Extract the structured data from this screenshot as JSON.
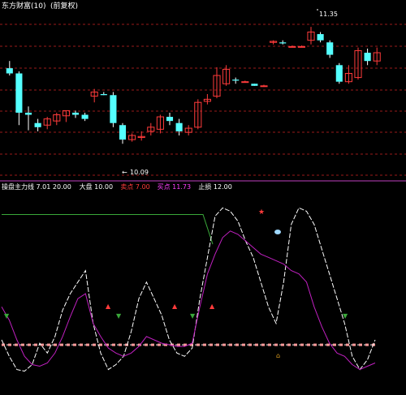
{
  "price_panel": {
    "header_label": "东方财富(10)",
    "header_sub": "(前复权)",
    "high_label": "11.35",
    "low_label": "10.09"
  },
  "indicator_panel": {
    "header_items": [
      {
        "text": "操盘主力线 7.01 20.00",
        "color": "#ffffff"
      },
      {
        "text": "大盘 10.00",
        "color": "#ffffff"
      },
      {
        "text": "卖点 7.00",
        "color": "#ff3b3b"
      },
      {
        "text": "买点 11.73",
        "color": "#ff40ff"
      },
      {
        "text": "止损 12.00",
        "color": "#ffffff"
      }
    ]
  },
  "colors": {
    "up": "#ff3b3b",
    "down": "#54ffff",
    "wick": "#ffffff",
    "grid": "#9a1a1a",
    "ma_white": "#ffffff",
    "ma_magenta": "#c020c0",
    "level_green": "#3aa83a",
    "band": "#ff9a9a"
  },
  "chart_data": [
    {
      "type": "candlestick",
      "title": "",
      "ylim": [
        9.9,
        11.5
      ],
      "candles": [
        {
          "o": 10.95,
          "h": 11.02,
          "l": 10.88,
          "c": 10.9
        },
        {
          "o": 10.9,
          "h": 10.92,
          "l": 10.4,
          "c": 10.52
        },
        {
          "o": 10.52,
          "h": 10.58,
          "l": 10.35,
          "c": 10.5
        },
        {
          "o": 10.42,
          "h": 10.46,
          "l": 10.34,
          "c": 10.38
        },
        {
          "o": 10.4,
          "h": 10.48,
          "l": 10.36,
          "c": 10.46
        },
        {
          "o": 10.44,
          "h": 10.52,
          "l": 10.4,
          "c": 10.5
        },
        {
          "o": 10.49,
          "h": 10.54,
          "l": 10.43,
          "c": 10.54
        },
        {
          "o": 10.52,
          "h": 10.54,
          "l": 10.47,
          "c": 10.5
        },
        {
          "o": 10.5,
          "h": 10.52,
          "l": 10.44,
          "c": 10.46
        },
        {
          "o": 10.68,
          "h": 10.75,
          "l": 10.62,
          "c": 10.72
        },
        {
          "o": 10.7,
          "h": 10.72,
          "l": 10.69,
          "c": 10.69
        },
        {
          "o": 10.69,
          "h": 10.72,
          "l": 10.38,
          "c": 10.42
        },
        {
          "o": 10.4,
          "h": 10.42,
          "l": 10.22,
          "c": 10.26
        },
        {
          "o": 10.26,
          "h": 10.32,
          "l": 10.24,
          "c": 10.3
        },
        {
          "o": 10.28,
          "h": 10.34,
          "l": 10.25,
          "c": 10.29
        },
        {
          "o": 10.34,
          "h": 10.42,
          "l": 10.3,
          "c": 10.38
        },
        {
          "o": 10.36,
          "h": 10.5,
          "l": 10.32,
          "c": 10.48
        },
        {
          "o": 10.48,
          "h": 10.52,
          "l": 10.4,
          "c": 10.44
        },
        {
          "o": 10.42,
          "h": 10.46,
          "l": 10.3,
          "c": 10.34
        },
        {
          "o": 10.33,
          "h": 10.4,
          "l": 10.3,
          "c": 10.37
        },
        {
          "o": 10.38,
          "h": 10.65,
          "l": 10.36,
          "c": 10.62
        },
        {
          "o": 10.63,
          "h": 10.7,
          "l": 10.6,
          "c": 10.65
        },
        {
          "o": 10.68,
          "h": 10.96,
          "l": 10.66,
          "c": 10.88
        },
        {
          "o": 10.8,
          "h": 10.98,
          "l": 10.78,
          "c": 10.94
        },
        {
          "o": 10.84,
          "h": 10.86,
          "l": 10.8,
          "c": 10.83
        },
        {
          "o": 10.82,
          "h": 10.83,
          "l": 10.82,
          "c": 10.82
        },
        {
          "o": 10.8,
          "h": 10.8,
          "l": 10.78,
          "c": 10.78
        },
        {
          "o": 10.78,
          "h": 10.79,
          "l": 10.77,
          "c": 10.78
        },
        {
          "o": 11.2,
          "h": 11.22,
          "l": 11.18,
          "c": 11.21
        },
        {
          "o": 11.2,
          "h": 11.22,
          "l": 11.18,
          "c": 11.19
        },
        {
          "o": 11.16,
          "h": 11.17,
          "l": 11.15,
          "c": 11.16
        },
        {
          "o": 11.16,
          "h": 11.17,
          "l": 11.15,
          "c": 11.16
        },
        {
          "o": 11.22,
          "h": 11.35,
          "l": 11.18,
          "c": 11.3
        },
        {
          "o": 11.28,
          "h": 11.3,
          "l": 11.2,
          "c": 11.22
        },
        {
          "o": 11.2,
          "h": 11.22,
          "l": 11.05,
          "c": 11.08
        },
        {
          "o": 10.98,
          "h": 11.0,
          "l": 10.8,
          "c": 10.82
        },
        {
          "o": 10.82,
          "h": 10.98,
          "l": 10.8,
          "c": 10.9
        },
        {
          "o": 10.86,
          "h": 11.15,
          "l": 10.84,
          "c": 11.12
        },
        {
          "o": 11.1,
          "h": 11.14,
          "l": 10.98,
          "c": 11.02
        },
        {
          "o": 11.02,
          "h": 11.15,
          "l": 10.98,
          "c": 11.1
        }
      ]
    },
    {
      "type": "line",
      "title": "",
      "ylim": [
        -10,
        110
      ],
      "reference_levels": [
        {
          "name": "upper",
          "value": 96
        },
        {
          "name": "band",
          "value": 17
        }
      ],
      "series": [
        {
          "values": [
            20,
            10,
            2,
            1,
            5,
            18,
            12,
            22,
            38,
            48,
            55,
            62,
            30,
            12,
            2,
            5,
            10,
            25,
            45,
            55,
            45,
            35,
            20,
            12,
            10,
            15,
            45,
            70,
            95,
            100,
            98,
            92,
            80,
            70,
            55,
            40,
            30,
            55,
            90,
            100,
            98,
            90,
            75,
            60,
            45,
            30,
            10,
            2,
            8,
            20
          ]
        },
        {
          "values": [
            40,
            32,
            20,
            10,
            5,
            4,
            6,
            12,
            22,
            34,
            45,
            48,
            30,
            22,
            15,
            12,
            10,
            12,
            16,
            22,
            20,
            18,
            17,
            16,
            16,
            18,
            40,
            60,
            72,
            82,
            86,
            84,
            80,
            76,
            72,
            70,
            68,
            66,
            62,
            60,
            55,
            40,
            28,
            18,
            12,
            10,
            5,
            2,
            4,
            6
          ]
        }
      ]
    }
  ]
}
